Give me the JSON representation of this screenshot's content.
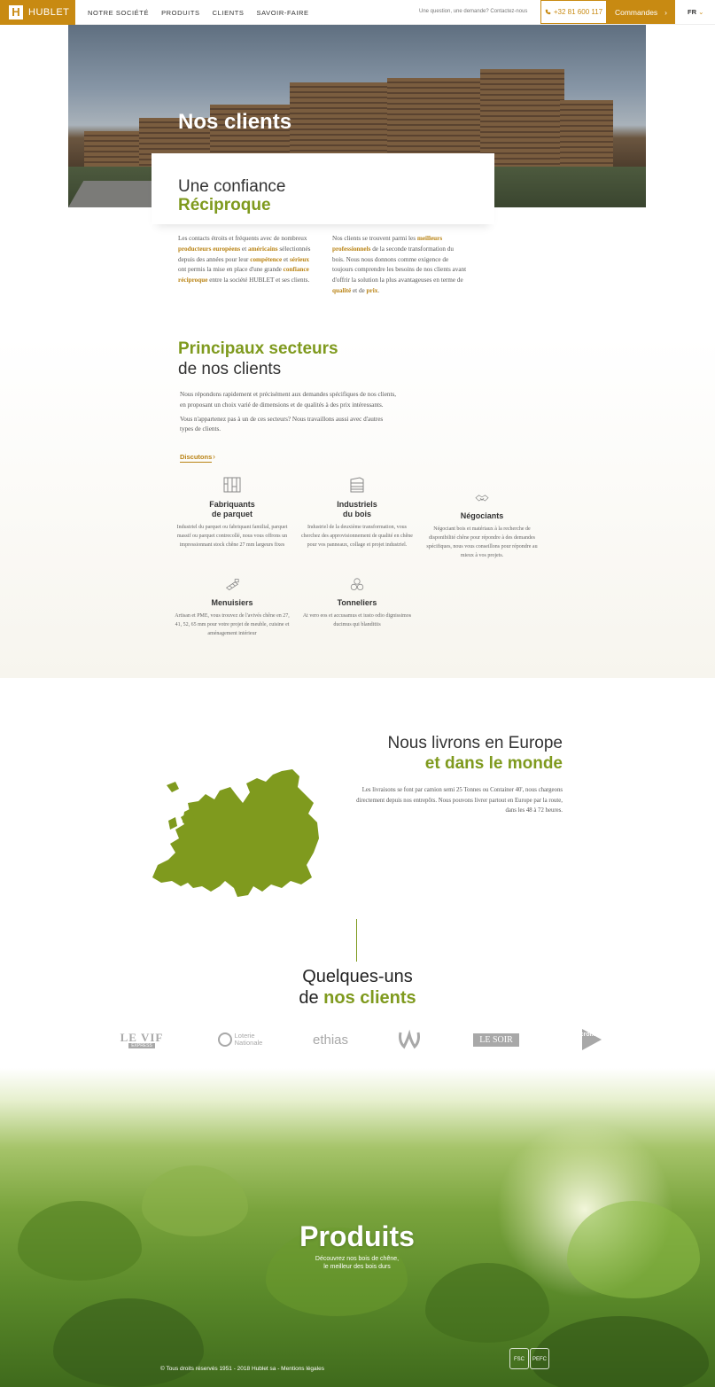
{
  "nav": {
    "logo_text": "HUBLET",
    "logo_mark": "H",
    "menu": [
      "NOTRE SOCIÉTÉ",
      "PRODUITS",
      "CLIENTS",
      "SAVOIR-FAIRE"
    ],
    "question": "Une question, une demande? Contactez-nous",
    "phone": "+32 81 600 117",
    "cta": "Commandes",
    "lang": "FR"
  },
  "hero": {
    "title": "Nos clients"
  },
  "intro": {
    "title_line1": "Une confiance",
    "title_line2": "Réciproque",
    "col1": {
      "t1": "Les contacts étroits et fréquents avec de nombreux ",
      "h1": "producteurs européens",
      "t2": " et ",
      "h2": "américains",
      "t3": " sélectionnés depuis des années pour leur ",
      "h3": "compétence",
      "t4": " et ",
      "h4": "sérieux",
      "t5": " ont permis la mise en place d'une grande ",
      "h5": "confiance réciproque",
      "t6": " entre la société HUBLET et ses clients."
    },
    "col2": {
      "t1": "Nos clients se trouvent parmi les ",
      "h1": "meilleurs professionnels",
      "t2": " de la seconde transformation du bois. Nous nous donnons comme exigence de toujours comprendre les besoins de nos clients avant d'offrir la solution la plus avantageuses en terme de ",
      "h2": "qualité",
      "t3": " et de ",
      "h3": "prix",
      "t4": "."
    }
  },
  "sectors": {
    "title_line1": "Principaux secteurs",
    "title_line2": "de nos clients",
    "para1": "Nous répondons rapidement et précisément aux demandes spécifiques de nos clients, en proposant un choix varié de dimensions et de qualités à des prix intéressants.",
    "para2": "Vous n'appartenez pas à un de ces secteurs? Nous travaillons aussi avec d'autres types de clients.",
    "discuss": "Discutons",
    "items": [
      {
        "icon": "parquet-icon",
        "name1": "Fabriquants",
        "name2": "de parquet",
        "desc": "Industriel du parquet ou fabriquant familial, parquet massif ou parquet contrecollé, nous vous offrons un impressionnant stock chêne 27 mm largeurs fixes"
      },
      {
        "icon": "industry-icon",
        "name1": "Industriels",
        "name2": "du bois",
        "desc": "Industriel de la deuxième transformation, vous cherchez des approvisionnement de qualité en chêne pour vos panneaux, collage et projet industriel."
      },
      {
        "icon": "handshake-icon",
        "name1": "Négociants",
        "name2": "",
        "desc": "Négociant bois et matériaux à la recherche de disponibilité chêne pour répondre à des demandes spécifiques, nous vous conseillons pour répondre au mieux à vos projets."
      },
      {
        "icon": "carpenter-icon",
        "name1": "Menuisiers",
        "name2": "",
        "desc": "Artisan et PME, vous trouvez de l'avivés chêne en 27, 41, 52, 65 mm pour votre projet de meuble, cuisine et aménagement intérieur"
      },
      {
        "icon": "barrels-icon",
        "name1": "Tonneliers",
        "name2": "",
        "desc": "At vero eos et accusamus et iusto odio dignissimos ducimus qui blanditiis"
      }
    ]
  },
  "europe": {
    "title_line1": "Nous livrons en Europe",
    "title_line2": "et dans le monde",
    "text": "Les livraisons se font par camion semi 25 Tonnes ou Container 40', nous chargeons directement depuis nos entrepôts. Nous pouvons livrer partout en Europe par la route, dans les 48 à 72 heures."
  },
  "clients": {
    "title_line1": "Quelques-uns",
    "title_line2_a": "de ",
    "title_line2_b": "nos clients",
    "logos": [
      "LE VIF",
      "EXPRESS",
      "Loterie",
      "Nationale",
      "ethias",
      "LE SOIR",
      "la croix"
    ]
  },
  "products": {
    "title": "Produits",
    "sub1": "Découvrez nos bois de chêne,",
    "sub2": "le meilleur des bois durs",
    "footer": "© Tous droits réservés 1951 - 2018 Hublet sa - Mentions légales",
    "cert1": "FSC",
    "cert2": "PEFC"
  },
  "colors": {
    "accent": "#c88a12",
    "green": "#7f9a1e"
  }
}
